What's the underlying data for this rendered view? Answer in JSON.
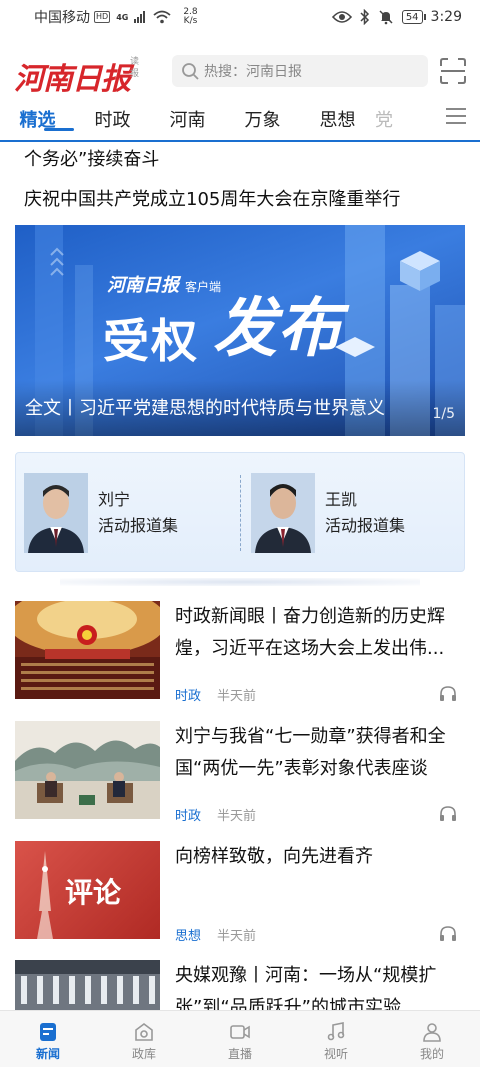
{
  "status_bar": {
    "carrier": "中国移动",
    "hd": "HD",
    "network": "4G",
    "speed_value": "2.8",
    "speed_unit": "K/s",
    "battery": "54",
    "time": "3:29"
  },
  "header": {
    "logo": "河南日报",
    "logo_sub": "读报",
    "search_placeholder": "热搜：河南日报"
  },
  "tabs": [
    {
      "label": "精选",
      "active": true
    },
    {
      "label": "时政"
    },
    {
      "label": "河南"
    },
    {
      "label": "万象"
    },
    {
      "label": "思想"
    },
    {
      "label": "党"
    }
  ],
  "ticker": {
    "line1": "个务必”接续奋斗",
    "line2": "庆祝中国共产党成立105周年大会在京隆重举行"
  },
  "banner": {
    "brand": "河南日报",
    "brand_sub": "客户端",
    "big_text_1": "受权",
    "big_text_2": "发布",
    "caption": "全文丨习近平党建思想的时代特质与世界意义",
    "pager": "1/5"
  },
  "leaders": [
    {
      "name": "刘宁",
      "subtitle": "活动报道集"
    },
    {
      "name": "王凯",
      "subtitle": "活动报道集"
    }
  ],
  "news": [
    {
      "title": "时政新闻眼丨奋力创造新的历史辉煌，习近平在这场大会上发出伟...",
      "category": "时政",
      "time": "半天前"
    },
    {
      "title": "刘宁与我省“七一勋章”获得者和全国“两优一先”表彰对象代表座谈",
      "category": "时政",
      "time": "半天前"
    },
    {
      "title": "向榜样致敬，向先进看齐",
      "category": "思想",
      "time": "半天前",
      "thumb_text": "评论"
    },
    {
      "title": "央媒观豫丨河南：一场从“规模扩张”到“品质跃升”的城市实验",
      "category": "",
      "time": ""
    }
  ],
  "bottom_nav": [
    {
      "label": "新闻",
      "icon": "news-icon",
      "active": true
    },
    {
      "label": "政库",
      "icon": "library-icon"
    },
    {
      "label": "直播",
      "icon": "live-icon"
    },
    {
      "label": "视听",
      "icon": "music-icon"
    },
    {
      "label": "我的",
      "icon": "profile-icon"
    }
  ],
  "colors": {
    "accent": "#1a6fd0",
    "logo_red": "#d7262b"
  }
}
